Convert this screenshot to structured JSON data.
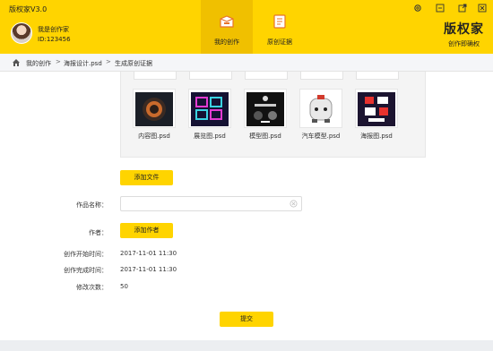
{
  "app": {
    "title": "版权家V3.0",
    "brand_name": "版权家",
    "brand_slogan": "创作即确权"
  },
  "user": {
    "name": "我是创作家",
    "id": "ID:123456"
  },
  "nav": [
    {
      "label": "我的创作",
      "active": true,
      "icon": "box-icon"
    },
    {
      "label": "原创证据",
      "active": false,
      "icon": "document-icon"
    }
  ],
  "window_controls": [
    "settings-icon",
    "minimize-icon",
    "popout-icon",
    "close-icon"
  ],
  "breadcrumb": {
    "items": [
      "我的创作",
      "海报设计.psd",
      "生成原创证据"
    ],
    "separator": ">"
  },
  "files": [
    {
      "name": "内容图.psd"
    },
    {
      "name": "展览图.psd"
    },
    {
      "name": "模型图.psd"
    },
    {
      "name": "汽车模型.psd"
    },
    {
      "name": "海报图.psd"
    }
  ],
  "buttons": {
    "add_file": "添加文件",
    "add_author": "添加作者",
    "submit": "提交"
  },
  "form": {
    "work_name_label": "作品名称：",
    "work_name_value": "",
    "author_label": "作者：",
    "start_time_label": "创作开始时间：",
    "start_time_value": "2017-11-01 11:30",
    "end_time_label": "创作完成时间：",
    "end_time_value": "2017-11-01 11:30",
    "edits_label": "修改次数：",
    "edits_value": "50"
  },
  "colors": {
    "accent": "#ffd400",
    "accent_active": "#f0c000"
  }
}
